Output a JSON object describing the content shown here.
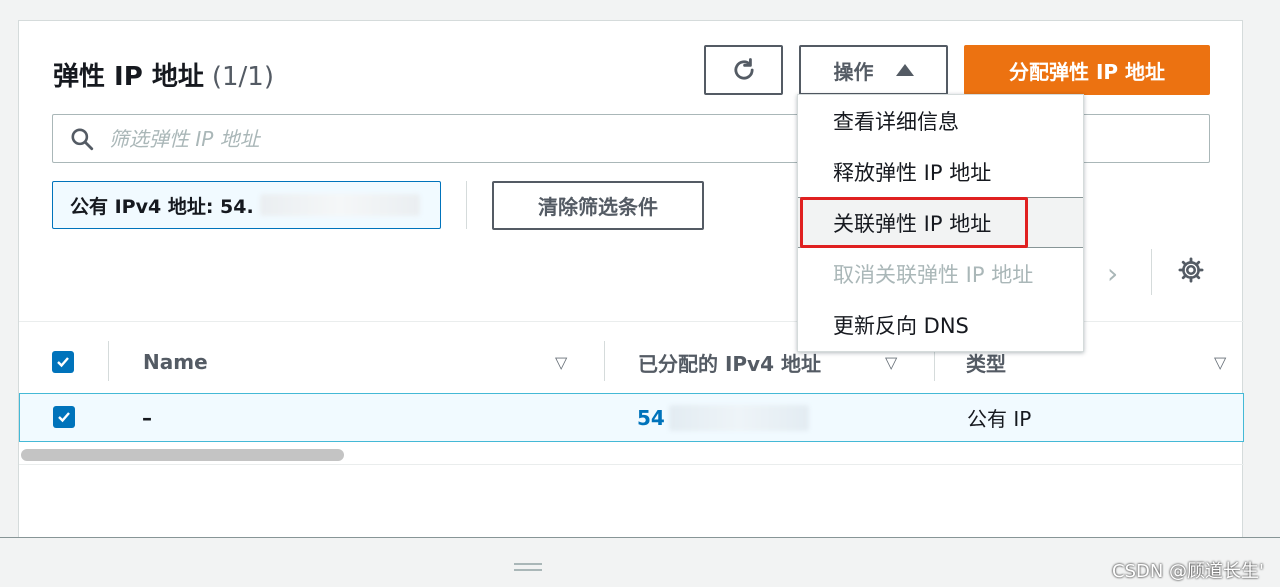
{
  "header": {
    "title": "弹性 IP 地址",
    "count": "(1/1)",
    "actions_label": "操作",
    "allocate_label": "分配弹性 IP 地址"
  },
  "search": {
    "placeholder": "筛选弹性 IP 地址"
  },
  "filter": {
    "token_label": "公有 IPv4 地址: 54.",
    "clear_label": "清除筛选条件"
  },
  "table": {
    "columns": [
      "Name",
      "已分配的 IPv4 地址",
      "类型"
    ],
    "rows": [
      {
        "name": "–",
        "ipv4": "54",
        "type": "公有 IP"
      }
    ]
  },
  "actions_menu": {
    "items": [
      {
        "label": "查看详细信息",
        "disabled": false
      },
      {
        "label": "释放弹性 IP 地址",
        "disabled": false
      },
      {
        "label": "关联弹性 IP 地址",
        "disabled": false
      },
      {
        "label": "取消关联弹性 IP 地址",
        "disabled": true
      },
      {
        "label": "更新反向 DNS",
        "disabled": false
      }
    ]
  },
  "colors": {
    "primary": "#ec7211",
    "link": "#0073bb",
    "highlight": "#e02020"
  },
  "watermark": "CSDN @顾道长生'"
}
